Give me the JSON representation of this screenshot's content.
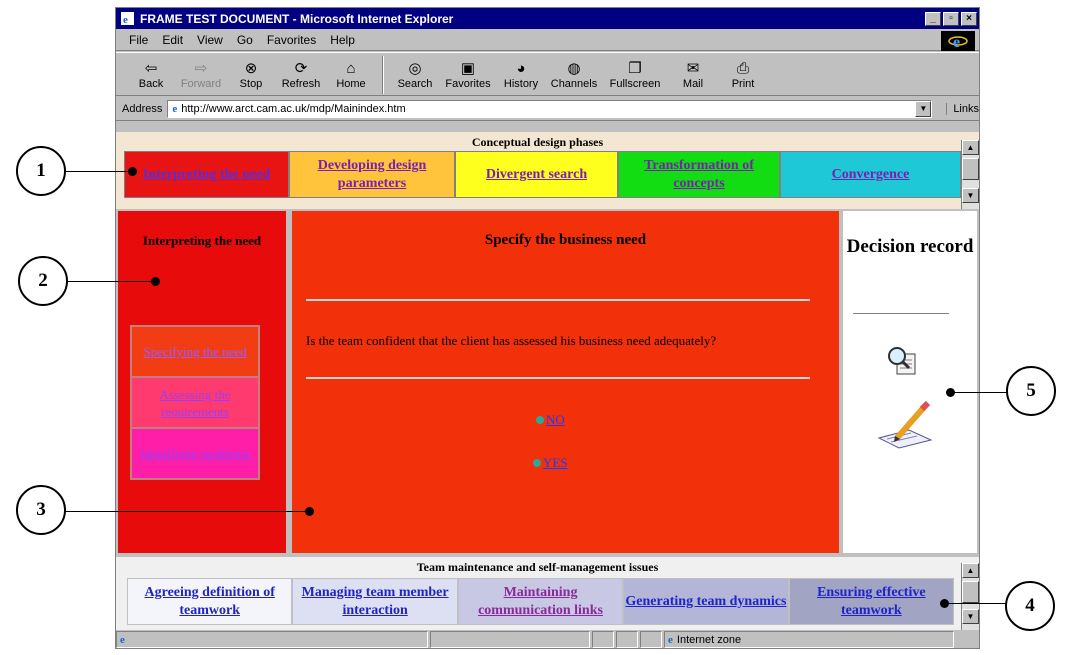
{
  "window": {
    "title": "FRAME TEST DOCUMENT - Microsoft Internet Explorer",
    "controls": [
      "_",
      "▫",
      "×"
    ]
  },
  "menu": [
    "File",
    "Edit",
    "View",
    "Go",
    "Favorites",
    "Help"
  ],
  "toolbar": [
    {
      "label": "Back",
      "icon": "back-arrow-icon"
    },
    {
      "label": "Forward",
      "icon": "forward-arrow-icon"
    },
    {
      "label": "Stop",
      "icon": "stop-icon"
    },
    {
      "label": "Refresh",
      "icon": "refresh-icon"
    },
    {
      "label": "Home",
      "icon": "home-icon"
    },
    {
      "label": "Search",
      "icon": "search-icon"
    },
    {
      "label": "Favorites",
      "icon": "favorites-icon"
    },
    {
      "label": "History",
      "icon": "history-icon"
    },
    {
      "label": "Channels",
      "icon": "channels-icon"
    },
    {
      "label": "Fullscreen",
      "icon": "fullscreen-icon"
    },
    {
      "label": "Mail",
      "icon": "mail-icon"
    },
    {
      "label": "Print",
      "icon": "print-icon"
    }
  ],
  "address": {
    "label": "Address",
    "url": "http://www.arct.cam.ac.uk/mdp/Mainindex.htm",
    "links_label": "Links"
  },
  "top_frame": {
    "header": "Conceptual design phases",
    "phases": [
      {
        "label": "Interpreting the need",
        "bg": "#e81414",
        "fg": "#5b2bd6"
      },
      {
        "label": "Developing design parameters",
        "bg": "#ffc43c",
        "fg": "#7a1fb0"
      },
      {
        "label": "Divergent search",
        "bg": "#ffff1e",
        "fg": "#7a1fb0"
      },
      {
        "label": "Transformation of concepts",
        "bg": "#12dc12",
        "fg": "#7a1fb0"
      },
      {
        "label": "Convergence",
        "bg": "#1ec8d6",
        "fg": "#7a1fb0"
      }
    ]
  },
  "left_frame": {
    "title": "Interpreting the need",
    "items": [
      {
        "label": "Specifying the need",
        "bg": "#f23c14",
        "fg": "#9a5cff"
      },
      {
        "label": "Assessing the requirements",
        "bg": "#ff3a6e",
        "fg": "#9a3cff"
      },
      {
        "label": "Identifying problems",
        "bg": "#ff1ea8",
        "fg": "#9a3cff"
      }
    ]
  },
  "main_frame": {
    "title": "Specify the business need",
    "question": "Is the team confident that the client has assessed his business need adequately?",
    "answers": [
      "NO",
      "YES"
    ]
  },
  "right_frame": {
    "title": "Decision record",
    "icons": [
      "magnifier-document-icon",
      "pencil-notepad-icon"
    ]
  },
  "bottom_frame": {
    "header": "Team maintenance and self-management issues",
    "items": [
      {
        "label": "Agreeing definition of teamwork",
        "bg": "#f4f4fb",
        "fg": "#1f24c8"
      },
      {
        "label": "Managing team member interaction",
        "bg": "#dde0f2",
        "fg": "#1f24c8"
      },
      {
        "label": "Maintaining communication links",
        "bg": "#c8c8e4",
        "fg": "#8a2a9a"
      },
      {
        "label": "Generating team dynamics",
        "bg": "#b4b6d8",
        "fg": "#1f24c8"
      },
      {
        "label": "Ensuring effective teamwork",
        "bg": "#a2a4c4",
        "fg": "#1f24c8"
      }
    ]
  },
  "status": {
    "zone": "Internet zone"
  },
  "callouts": [
    "1",
    "2",
    "3",
    "4",
    "5"
  ]
}
